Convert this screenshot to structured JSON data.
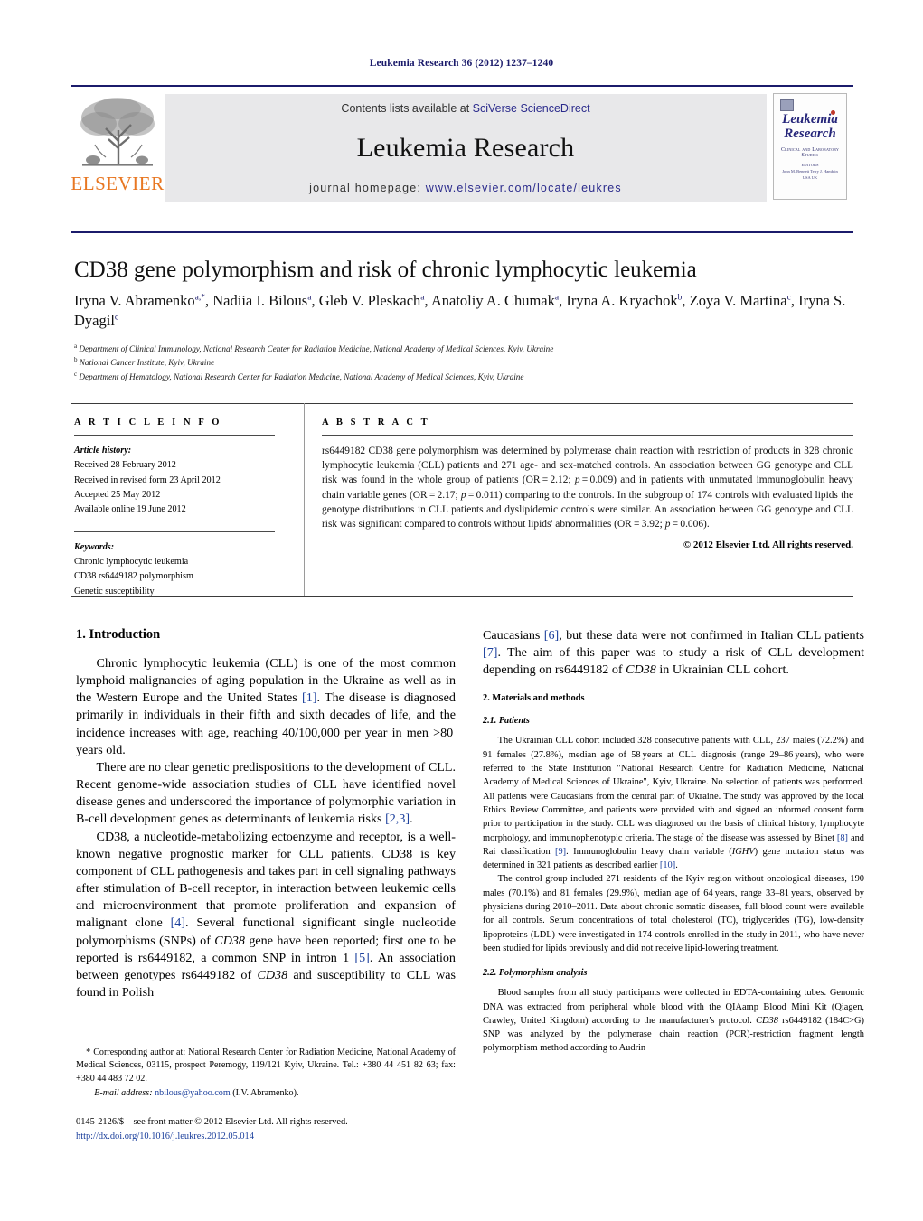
{
  "running_head": "Leukemia Research 36 (2012) 1237–1240",
  "banner": {
    "publisher_name": "ELSEVIER",
    "contents_prefix": "Contents lists available at ",
    "contents_link": "SciVerse ScienceDirect",
    "journal_name": "Leukemia Research",
    "homepage_prefix": "journal homepage: ",
    "homepage_url": "www.elsevier.com/locate/leukres",
    "cover": {
      "title_line1": "Leukemia",
      "title_line2": "Research",
      "subtitle": "Clinical and Laboratory Studies",
      "meta_line1": "EDITORS",
      "meta_line2": "John M. Bennett        Terry J. Hamblin",
      "meta_line3": "USA                              UK"
    }
  },
  "article": {
    "title": "CD38 gene polymorphism and risk of chronic lymphocytic leukemia",
    "authors_line1": "Iryna V. Abramenko",
    "authors_html": "Iryna V. Abramenko<sup>a,*</sup>, Nadiia I. Bilous<sup>a</sup>, Gleb V. Pleskach<sup>a</sup>, Anatoliy A. Chumak<sup>a</sup>, Iryna A. Kryachok<sup>b</sup>, Zoya V. Martina<sup>c</sup>, Iryna S. Dyagil<sup>c</sup>",
    "affiliations": [
      {
        "marker": "a",
        "text": "Department of Clinical Immunology, National Research Center for Radiation Medicine, National Academy of Medical Sciences, Kyiv, Ukraine"
      },
      {
        "marker": "b",
        "text": "National Cancer Institute, Kyiv, Ukraine"
      },
      {
        "marker": "c",
        "text": "Department of Hematology, National Research Center for Radiation Medicine, National Academy of Medical Sciences, Kyiv, Ukraine"
      }
    ]
  },
  "article_info": {
    "heading": "A R T I C L E    I N F O",
    "history_label": "Article history:",
    "history": [
      "Received 28 February 2012",
      "Received in revised form 23 April 2012",
      "Accepted 25 May 2012",
      "Available online 19 June 2012"
    ],
    "keywords_label": "Keywords:",
    "keywords": [
      "Chronic lymphocytic leukemia",
      "CD38 rs6449182 polymorphism",
      "Genetic susceptibility"
    ]
  },
  "abstract": {
    "heading": "A B S T R A C T",
    "body_html": "rs6449182 CD38 gene polymorphism was determined by polymerase chain reaction with restriction of products in 328 chronic lymphocytic leukemia (CLL) patients and 271 age- and sex-matched controls. An association between GG genotype and CLL risk was found in the whole group of patients (OR = 2.12; <i>p</i> = 0.009) and in patients with unmutated immunoglobulin heavy chain variable genes (OR = 2.17; <i>p</i> = 0.011) comparing to the controls. In the subgroup of 174 controls with evaluated lipids the genotype distributions in CLL patients and dyslipidemic controls were similar. An association between GG genotype and CLL risk was significant compared to controls without lipids' abnormalities (OR = 3.92; <i>p</i> = 0.006).",
    "copyright": "© 2012 Elsevier Ltd. All rights reserved."
  },
  "sections": {
    "intro_heading": "1.  Introduction",
    "intro_p1_html": "Chronic lymphocytic leukemia (CLL) is one of the most common lymphoid malignancies of aging population in the Ukraine as well as in the Western Europe and the United States <span class=\"ref\">[1]</span>. The disease is diagnosed primarily in individuals in their fifth and sixth decades of life, and the incidence increases with age, reaching 40/100,000 per year in men >80 years old.",
    "intro_p2_html": "There are no clear genetic predispositions to the development of CLL. Recent genome-wide association studies of CLL have identified novel disease genes and underscored the importance of polymorphic variation in B-cell development genes as determinants of leukemia risks <span class=\"ref\">[2,3]</span>.",
    "intro_p3_html": "CD38, a nucleotide-metabolizing ectoenzyme and receptor, is a well-known negative prognostic marker for CLL patients. CD38 is key component of CLL pathogenesis and takes part in cell signaling pathways after stimulation of B-cell receptor, in interaction between leukemic cells and microenvironment that promote proliferation and expansion of malignant clone <span class=\"ref\">[4]</span>. Several functional significant single nucleotide polymorphisms (SNPs) of <span class=\"ital\">CD38</span> gene have been reported; first one to be reported is rs6449182, a common SNP in intron 1 <span class=\"ref\">[5]</span>. An association between genotypes rs6449182 of <span class=\"ital\">CD38</span> and susceptibility to CLL was found in Polish",
    "intro_p3_cont_html": "Caucasians <span class=\"ref\">[6]</span>, but these data were not confirmed in Italian CLL patients <span class=\"ref\">[7]</span>. The aim of this paper was to study a risk of CLL development depending on rs6449182 of <span class=\"ital\">CD38</span> in Ukrainian CLL cohort.",
    "methods_heading": "2.  Materials and methods",
    "patients_heading": "2.1.   Patients",
    "patients_p1_html": "The Ukrainian CLL cohort included 328 consecutive patients with CLL, 237 males (72.2%) and 91 females (27.8%), median age of 58 years at CLL diagnosis (range 29–86 years), who were referred to the State Institution \"National Research Centre for Radiation Medicine, National Academy of Medical Sciences of Ukraine\", Kyiv, Ukraine. No selection of patients was performed. All patients were Caucasians from the central part of Ukraine. The study was approved by the local Ethics Review Committee, and patients were provided with and signed an informed consent form prior to participation in the study. CLL was diagnosed on the basis of clinical history, lymphocyte morphology, and immunophenotypic criteria. The stage of the disease was assessed by Binet <span class=\"ref\">[8]</span> and Rai classification <span class=\"ref\">[9]</span>. Immunoglobulin heavy chain variable (<span class=\"ital\">IGHV</span>) gene mutation status was determined in 321 patients as described earlier <span class=\"ref\">[10]</span>.",
    "patients_p2_html": "The control group included 271 residents of the Kyiv region without oncological diseases, 190 males (70.1%) and 81 females (29.9%), median age of 64 years, range 33–81 years, observed by physicians during 2010–2011. Data about chronic somatic diseases, full blood count were available for all controls. Serum concentrations of total cholesterol (TC), triglycerides (TG), low-density lipoproteins (LDL) were investigated in 174 controls enrolled in the study in 2011, who have never been studied for lipids previously and did not receive lipid-lowering treatment.",
    "polymorphism_heading": "2.2.   Polymorphism analysis",
    "polymorphism_p1_html": "Blood samples from all study participants were collected in EDTA-containing tubes. Genomic DNA was extracted from peripheral whole blood with the QIAamp Blood Mini Kit (Qiagen, Crawley, United Kingdom) according to the manufacturer's protocol. <span class=\"ital\">CD38</span> rs6449182 (184C>G) SNP was analyzed by the polymerase chain reaction (PCR)-restriction fragment length polymorphism method according to Audrin"
  },
  "footnotes": {
    "corresponding_html": "* Corresponding author at: National Research Center for Radiation Medicine, National Academy of Medical Sciences, 03115, prospect Peremogy, 119/121 Kyiv, Ukraine. Tel.: +380 44 451 82 63; fax: +380 44 483 72 02.",
    "email_label": "E-mail address:",
    "email": "nbilous@yahoo.com",
    "email_owner": "(I.V. Abramenko).",
    "imprint_line": "0145-2126/$ – see front matter © 2012 Elsevier Ltd. All rights reserved.",
    "doi": "http://dx.doi.org/10.1016/j.leukres.2012.05.014"
  },
  "colors": {
    "header_blue": "#1b1b6b",
    "link_blue": "#2b2b8c",
    "ref_blue": "#1b3f9c",
    "elsevier_orange": "#e87722",
    "banner_grey": "#e8e8ea"
  }
}
